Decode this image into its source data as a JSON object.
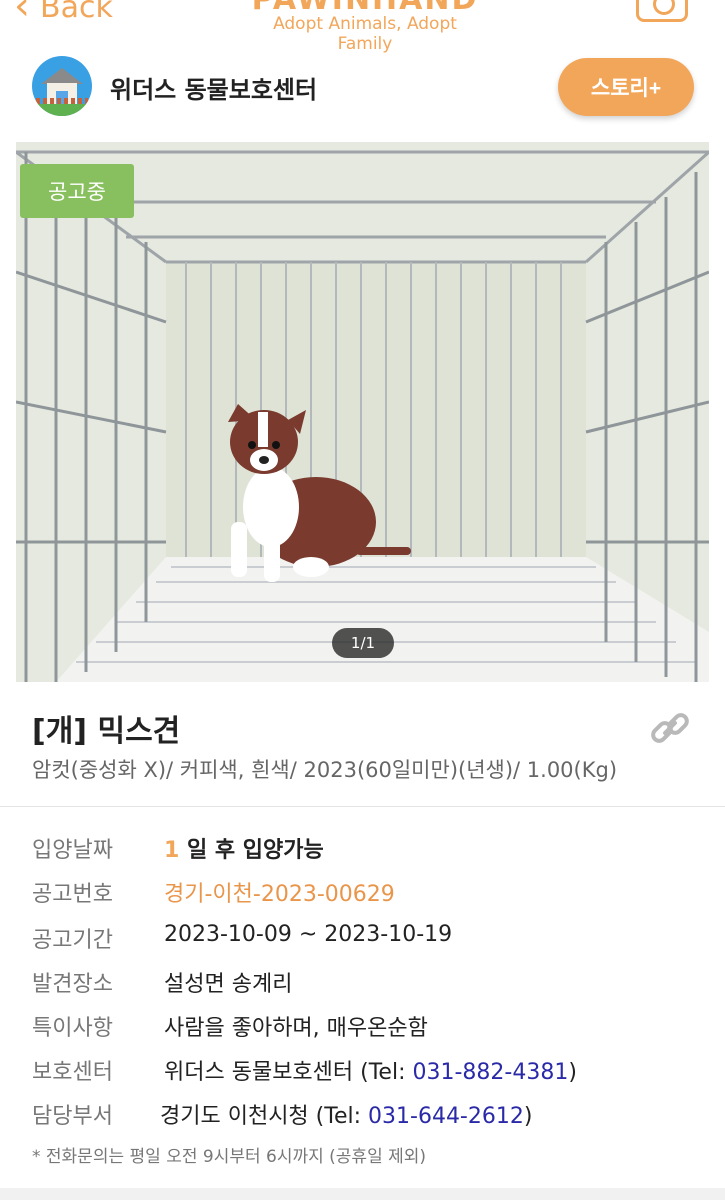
{
  "topbar": {
    "back_label": "Back",
    "brand_name": "PAWINHAND",
    "brand_slogan": "Adopt Animals, Adopt Family",
    "camera_icon": "camera-icon",
    "accent_color": "#f2a65a"
  },
  "shelter": {
    "name": "위더스 동물보호센터",
    "story_button": "스토리+"
  },
  "photo": {
    "badge": "공고중",
    "counter": "1/1"
  },
  "animal": {
    "title": "[개] 믹스견",
    "description": "암컷(중성화 X)/ 커피색, 흰색/ 2023(60일미만)(년생)/ 1.00(Kg)"
  },
  "info": {
    "adopt_date_label": "입양날짜",
    "adopt_date_num": "1",
    "adopt_date_text": " 일 후 입양가능",
    "notice_no_label": "공고번호",
    "notice_no": "경기-이천-2023-00629",
    "period_label": "공고기간",
    "period": "2023-10-09 ~ 2023-10-19",
    "found_label": "발견장소",
    "found": "설성면 송계리",
    "feature_label": "특이사항",
    "feature": "사람을 좋아하며, 매우온순함",
    "center_label": "보호센터",
    "center_name": "위더스 동물보호센터 (Tel: ",
    "center_tel": "031-882-4381",
    "center_close": ")",
    "dept_label": "담당부서",
    "dept_name": "경기도 이천시청 (Tel: ",
    "dept_tel": "031-644-2612",
    "dept_close": ")",
    "note": "* 전화문의는 평일 오전 9시부터 6시까지 (공휴일 제외)"
  }
}
